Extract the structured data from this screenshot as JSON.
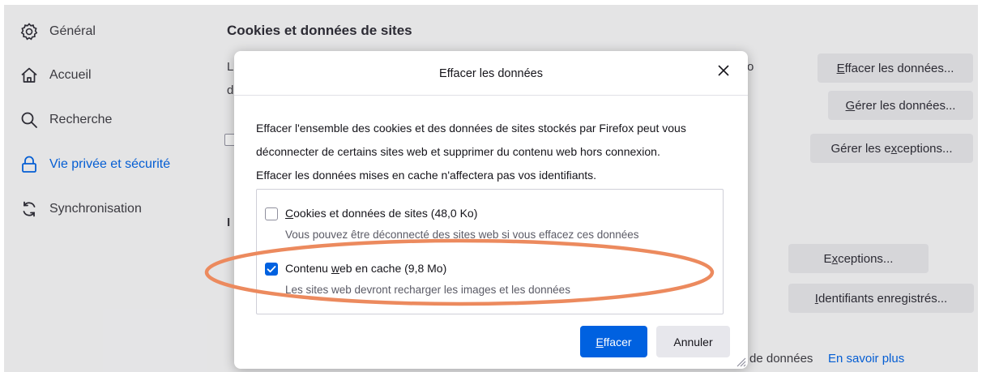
{
  "sidebar": {
    "items": [
      {
        "label": "Général",
        "icon": "gear-icon"
      },
      {
        "label": "Accueil",
        "icon": "home-icon"
      },
      {
        "label": "Recherche",
        "icon": "search-icon"
      },
      {
        "label": "Vie privée et sécurité",
        "icon": "lock-icon",
        "active": true
      },
      {
        "label": "Synchronisation",
        "icon": "sync-icon"
      }
    ]
  },
  "main": {
    "section_title": "Cookies et données de sites",
    "buttons": {
      "clear_data": {
        "mnemonic": "E",
        "rest": "ffacer les données..."
      },
      "manage_data": {
        "mnemonic": "G",
        "rest": "érer les données..."
      },
      "manage_exceptions": {
        "pre": "Gérer les e",
        "mnemonic": "x",
        "post": "ceptions..."
      },
      "exceptions": {
        "pre": "E",
        "mnemonic": "x",
        "post": "ceptions..."
      },
      "saved_logins": {
        "mnemonic": "I",
        "rest": "dentifiants enregistrés..."
      }
    },
    "footer_text": "de données",
    "learn_more": "En savoir plus",
    "fragments": {
      "l1": "L",
      "d1": "d",
      "o1": "o",
      "i1": "I"
    }
  },
  "dialog": {
    "title": "Effacer les données",
    "description_lines": [
      "Effacer l'ensemble des cookies et des données de sites stockés par Firefox peut vous",
      "déconnecter de certains sites web et supprimer du contenu web hors connexion.",
      "Effacer les données mises en cache n'affectera pas vos identifiants."
    ],
    "options": [
      {
        "mnemonic": "C",
        "rest": "ookies et données de sites (48,0 Ko)",
        "sub": "Vous pouvez être déconnecté des sites web si vous effacez ces données",
        "checked": false
      },
      {
        "pre": "Contenu ",
        "mnemonic": "w",
        "post": "eb en cache (9,8 Mo)",
        "sub": "Les sites web devront recharger les images et les données",
        "checked": true
      }
    ],
    "primary_button": {
      "mnemonic": "E",
      "rest": "ffacer"
    },
    "secondary_button": "Annuler"
  },
  "colors": {
    "accent": "#0061e0",
    "highlight_ellipse": "#ec8a5e"
  }
}
